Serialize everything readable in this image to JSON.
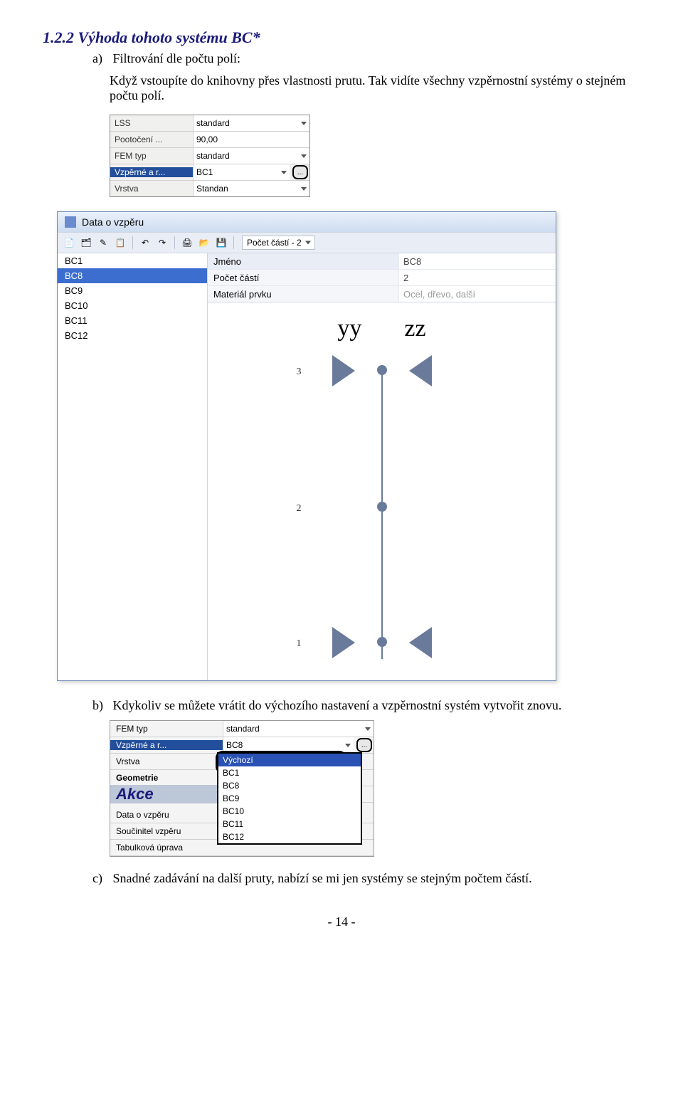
{
  "heading": "1.2.2  Výhoda tohoto systému BC*",
  "items": {
    "a": {
      "letter": "a)",
      "text": "Filtrování dle počtu polí:",
      "cont": "Když vstoupíte do knihovny přes vlastnosti prutu. Tak vidíte všechny vzpěrnostní systémy o stejném počtu polí."
    },
    "b": {
      "letter": "b)",
      "text": "Kdykoliv se můžete vrátit do výchozího nastavení a vzpěrnostní systém vytvořit znovu."
    },
    "c": {
      "letter": "c)",
      "text": "Snadné zadávání na další pruty, nabízí se mi jen systémy se stejným počtem částí."
    }
  },
  "mini1": {
    "rows": [
      {
        "label": "LSS",
        "val": "standard",
        "dd": true
      },
      {
        "label": "Pootočení ...",
        "val": "90,00"
      },
      {
        "label": "FEM typ",
        "val": "standard",
        "dd": true
      },
      {
        "label": "Vzpěrné a r...",
        "val": "BC1",
        "dd": true,
        "sel": true,
        "btn": true
      },
      {
        "label": "Vrstva",
        "val": "Standan",
        "dd": true
      }
    ]
  },
  "dialog": {
    "title": "Data o vzpěru",
    "toolbar_label": "Počet částí - 2",
    "list": [
      "BC1",
      "BC8",
      "BC9",
      "BC10",
      "BC11",
      "BC12"
    ],
    "selected": "BC8",
    "props": [
      {
        "label": "Jméno",
        "val": "BC8",
        "hdr": true
      },
      {
        "label": "Počet částí",
        "val": "2"
      },
      {
        "label": "Materiál prvku",
        "val": "Ocel, dřevo, další",
        "ph": true
      }
    ],
    "axis": {
      "y": "yy",
      "z": "zz"
    },
    "nums": [
      "3",
      "2",
      "1"
    ]
  },
  "mini2": {
    "rows": [
      {
        "label": "FEM typ",
        "val": "standard",
        "dd": true
      },
      {
        "label": "Vzpěrné a r...",
        "val": "BC8",
        "dd": true,
        "sel": true,
        "btn": true
      },
      {
        "label": "Vrstva"
      },
      {
        "label": "Geometrie",
        "bold": true
      },
      {
        "label": "Akce",
        "heading": true
      },
      {
        "label": "Data o vzpěru"
      },
      {
        "label": "Součinitel vzpěru"
      },
      {
        "label": "Tabulková úprava"
      }
    ],
    "dropdown": [
      "Výchozí",
      "BC1",
      "BC8",
      "BC9",
      "BC10",
      "BC11",
      "BC12"
    ],
    "dropdown_hl": "Výchozí"
  },
  "page_num": "- 14 -"
}
